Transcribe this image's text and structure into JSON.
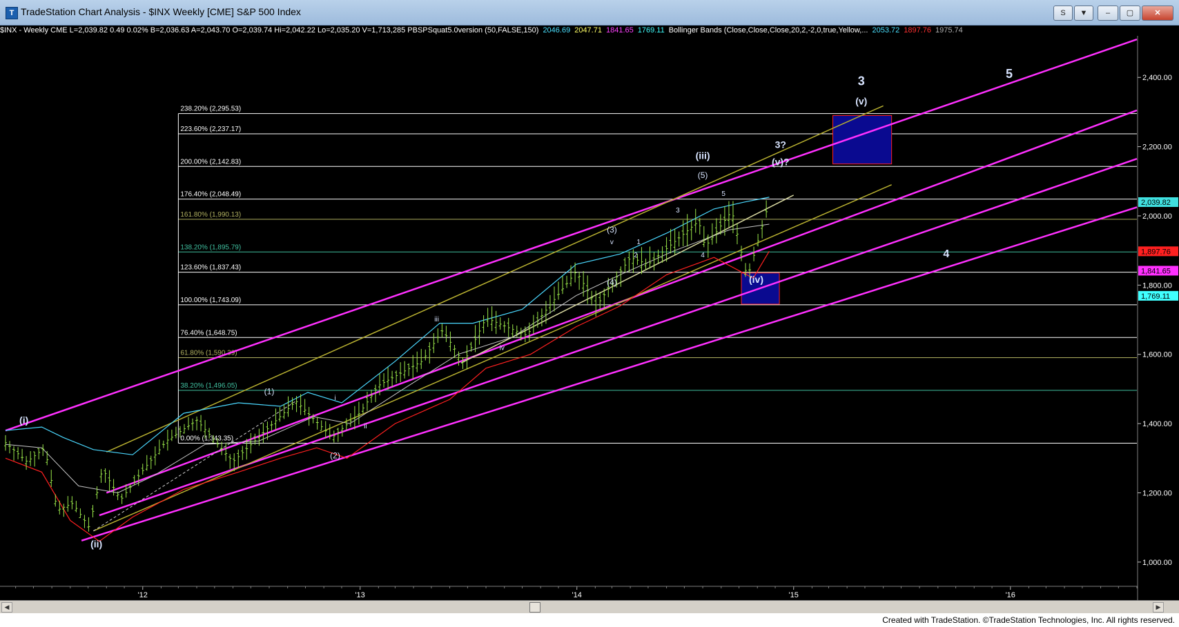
{
  "window": {
    "title": "TradeStation Chart Analysis - $INX Weekly [CME] S&P 500 Index",
    "btn_s": "S",
    "btn_chart": "▼",
    "btn_min": "–",
    "btn_max": "▢",
    "btn_close": "✕"
  },
  "status_line": [
    {
      "text": "$INX - Weekly  CME  L=2,039.82  0.49  0.02%  B=2,036.63  A=2,043.70  O=2,039.74  Hi=2,042.22  Lo=2,035.20  V=1,713,285  PBSPSquat5.0version (50,FALSE,150)",
      "color": "#ffffff"
    },
    {
      "text": "2046.69",
      "color": "#4ae0ff"
    },
    {
      "text": "2047.71",
      "color": "#ffff66"
    },
    {
      "text": "1841.65",
      "color": "#ff40ff"
    },
    {
      "text": "1769.11",
      "color": "#40ffff"
    },
    {
      "text": "Bollinger Bands (Close,Close,Close,20,2,-2,0,true,Yellow,...",
      "color": "#ffffff"
    },
    {
      "text": "2053.72",
      "color": "#4ae0ff"
    },
    {
      "text": "1897.76",
      "color": "#ff3030"
    },
    {
      "text": "1975.74",
      "color": "#b0b0b0"
    }
  ],
  "footer": {
    "text": "Created with TradeStation. ©TradeStation Technologies, Inc. All rights reserved."
  },
  "colors": {
    "channel": "#ff30ff",
    "yellow_channel": "#b8b030",
    "bar": "#9be84a",
    "bb_upper": "#4ad8ff",
    "bb_lower": "#ff2020",
    "bb_mid": "#c8c8c8",
    "label": "#d8e4ff",
    "fib_white": "#ffffff",
    "fib_olive": "#b0b060",
    "fib_teal": "#40c0a0",
    "box": "#0a0a90"
  },
  "chart_data": {
    "type": "candlestick",
    "y_range": [
      930,
      2520
    ],
    "y_ticks": [
      1000,
      1200,
      1400,
      1600,
      1800,
      2000,
      2200,
      2400
    ],
    "y_tick_labels": [
      "1,000.00",
      "1,200.00",
      "1,400.00",
      "1,600.00",
      "1,800.00",
      "2,000.00",
      "2,200.00",
      "2,400.00"
    ],
    "x_range": [
      "2011-05-15",
      "2016-08-01"
    ],
    "x_ticks": [
      {
        "date": "2012-01-01",
        "label": "'12"
      },
      {
        "date": "2013-01-01",
        "label": "'13"
      },
      {
        "date": "2014-01-01",
        "label": "'14"
      },
      {
        "date": "2015-01-01",
        "label": "'15"
      },
      {
        "date": "2016-01-01",
        "label": "'16"
      }
    ],
    "price_path": [
      [
        "2011-05-15",
        1345
      ],
      [
        "2011-06-20",
        1290
      ],
      [
        "2011-07-20",
        1330
      ],
      [
        "2011-08-10",
        1150
      ],
      [
        "2011-09-05",
        1170
      ],
      [
        "2011-10-03",
        1100
      ],
      [
        "2011-10-25",
        1270
      ],
      [
        "2011-11-25",
        1180
      ],
      [
        "2011-12-30",
        1260
      ],
      [
        "2012-02-10",
        1350
      ],
      [
        "2012-04-01",
        1410
      ],
      [
        "2012-06-01",
        1290
      ],
      [
        "2012-07-20",
        1370
      ],
      [
        "2012-09-15",
        1465
      ],
      [
        "2012-11-15",
        1360
      ],
      [
        "2012-12-31",
        1430
      ],
      [
        "2013-02-01",
        1510
      ],
      [
        "2013-04-15",
        1580
      ],
      [
        "2013-05-20",
        1670
      ],
      [
        "2013-06-24",
        1575
      ],
      [
        "2013-08-01",
        1705
      ],
      [
        "2013-10-08",
        1655
      ],
      [
        "2013-12-31",
        1840
      ],
      [
        "2014-02-03",
        1740
      ],
      [
        "2014-04-01",
        1880
      ],
      [
        "2014-05-01",
        1860
      ],
      [
        "2014-07-25",
        1985
      ],
      [
        "2014-08-05",
        1910
      ],
      [
        "2014-09-19",
        2015
      ],
      [
        "2014-10-15",
        1820
      ],
      [
        "2014-11-21",
        2042
      ]
    ],
    "last_price": 2039.82,
    "bollinger_upper": [
      [
        "2011-05-15",
        1380
      ],
      [
        "2011-07-15",
        1390
      ],
      [
        "2011-08-20",
        1360
      ],
      [
        "2011-10-10",
        1325
      ],
      [
        "2011-12-15",
        1310
      ],
      [
        "2012-03-10",
        1430
      ],
      [
        "2012-06-10",
        1460
      ],
      [
        "2012-08-20",
        1450
      ],
      [
        "2012-10-05",
        1490
      ],
      [
        "2012-12-01",
        1460
      ],
      [
        "2013-03-01",
        1580
      ],
      [
        "2013-05-15",
        1690
      ],
      [
        "2013-07-10",
        1690
      ],
      [
        "2013-10-01",
        1730
      ],
      [
        "2013-12-31",
        1860
      ],
      [
        "2014-03-15",
        1890
      ],
      [
        "2014-06-01",
        1950
      ],
      [
        "2014-08-20",
        2020
      ],
      [
        "2014-10-10",
        2040
      ],
      [
        "2014-11-21",
        2054
      ]
    ],
    "bollinger_lower": [
      [
        "2011-05-15",
        1300
      ],
      [
        "2011-07-15",
        1260
      ],
      [
        "2011-09-01",
        1120
      ],
      [
        "2011-10-20",
        1060
      ],
      [
        "2011-12-15",
        1130
      ],
      [
        "2012-03-10",
        1210
      ],
      [
        "2012-06-10",
        1260
      ],
      [
        "2012-08-20",
        1300
      ],
      [
        "2012-10-20",
        1330
      ],
      [
        "2012-12-10",
        1300
      ],
      [
        "2013-03-01",
        1400
      ],
      [
        "2013-06-01",
        1470
      ],
      [
        "2013-08-01",
        1560
      ],
      [
        "2013-10-15",
        1600
      ],
      [
        "2013-12-31",
        1680
      ],
      [
        "2014-03-15",
        1740
      ],
      [
        "2014-06-01",
        1830
      ],
      [
        "2014-08-20",
        1880
      ],
      [
        "2014-10-25",
        1820
      ],
      [
        "2014-11-21",
        1898
      ]
    ],
    "bollinger_mid": [
      [
        "2011-05-15",
        1340
      ],
      [
        "2011-07-15",
        1330
      ],
      [
        "2011-09-15",
        1220
      ],
      [
        "2011-11-20",
        1200
      ],
      [
        "2012-01-20",
        1250
      ],
      [
        "2012-04-15",
        1340
      ],
      [
        "2012-07-15",
        1350
      ],
      [
        "2012-10-15",
        1420
      ],
      [
        "2012-12-15",
        1400
      ],
      [
        "2013-03-15",
        1500
      ],
      [
        "2013-06-15",
        1600
      ],
      [
        "2013-09-15",
        1650
      ],
      [
        "2013-12-31",
        1770
      ],
      [
        "2014-03-15",
        1830
      ],
      [
        "2014-06-15",
        1900
      ],
      [
        "2014-09-15",
        1960
      ],
      [
        "2014-11-21",
        1976
      ]
    ],
    "fib_levels": [
      {
        "label": "238.20% (2,295.53)",
        "value": 2295.53,
        "color": "#ffffff"
      },
      {
        "label": "223.60% (2,237.17)",
        "value": 2237.17,
        "color": "#ffffff"
      },
      {
        "label": "200.00% (2,142.83)",
        "value": 2142.83,
        "color": "#ffffff"
      },
      {
        "label": "176.40% (2,048.49)",
        "value": 2048.49,
        "color": "#ffffff"
      },
      {
        "label": "161.80% (1,990.13)",
        "value": 1990.13,
        "color": "#b0b060"
      },
      {
        "label": "138.20% (1,895.79)",
        "value": 1895.79,
        "color": "#40c0a0"
      },
      {
        "label": "123.60% (1,837.43)",
        "value": 1837.43,
        "color": "#ffffff"
      },
      {
        "label": "100.00% (1,743.09)",
        "value": 1743.09,
        "color": "#ffffff"
      },
      {
        "label": "76.40% (1,648.75)",
        "value": 1648.75,
        "color": "#ffffff"
      },
      {
        "label": "61.80% (1,590.39)",
        "value": 1590.39,
        "color": "#b0b060"
      },
      {
        "label": "38.20% (1,496.05)",
        "value": 1496.05,
        "color": "#40c0a0"
      },
      {
        "label": "0.00% (1,343.35)",
        "value": 1343.35,
        "color": "#ffffff"
      }
    ],
    "fib_start_date": "2012-03-01",
    "axis_markers": [
      {
        "value": 2039.82,
        "label": "2,039.82",
        "bg": "#40e0e0",
        "fg": "#000000"
      },
      {
        "value": 1897.76,
        "label": "1,897.76",
        "bg": "#ff2020",
        "fg": "#000000"
      },
      {
        "value": 1841.65,
        "label": "1,841.65",
        "bg": "#ff30ff",
        "fg": "#000000"
      },
      {
        "value": 1769.11,
        "label": "1,769.11",
        "bg": "#40ffff",
        "fg": "#000000"
      }
    ],
    "channel_lines": [
      {
        "from": [
          "2011-05-15",
          1380
        ],
        "to": [
          "2016-08-01",
          2510
        ],
        "color": "#ff30ff"
      },
      {
        "from": [
          "2011-11-01",
          1200
        ],
        "to": [
          "2016-08-01",
          2305
        ],
        "color": "#ff30ff"
      },
      {
        "from": [
          "2011-10-20",
          1135
        ],
        "to": [
          "2016-08-01",
          2165
        ],
        "color": "#ff30ff"
      },
      {
        "from": [
          "2011-09-20",
          1062
        ],
        "to": [
          "2016-08-01",
          2025
        ],
        "color": "#ff30ff"
      }
    ],
    "yellow_lines": [
      {
        "from": [
          "2011-11-01",
          1318
        ],
        "to": [
          "2015-06-01",
          2318
        ],
        "color": "#b8b030"
      },
      {
        "from": [
          "2011-10-10",
          1090
        ],
        "to": [
          "2015-06-15",
          2090
        ],
        "color": "#b8b030"
      },
      {
        "from": [
          "2013-06-20",
          1575
        ],
        "to": [
          "2015-01-01",
          2060
        ],
        "color": "#d8d8a0"
      }
    ],
    "boxes": [
      {
        "x0": "2015-03-08",
        "x1": "2015-06-15",
        "y0": 2150,
        "y1": 2290
      },
      {
        "x0": "2014-10-05",
        "x1": "2014-12-08",
        "y0": 1745,
        "y1": 1835
      }
    ],
    "annotations": [
      {
        "text": "3",
        "date": "2015-04-25",
        "value": 2378,
        "size": 18,
        "bold": true
      },
      {
        "text": "(v)",
        "date": "2015-04-25",
        "value": 2322,
        "size": 14,
        "bold": true
      },
      {
        "text": "5",
        "date": "2015-12-30",
        "value": 2398,
        "size": 18,
        "bold": true
      },
      {
        "text": "3?",
        "date": "2014-12-10",
        "value": 2196,
        "size": 14,
        "bold": true
      },
      {
        "text": "(v)?",
        "date": "2014-12-10",
        "value": 2146,
        "size": 14,
        "bold": true
      },
      {
        "text": "(iii)",
        "date": "2014-08-01",
        "value": 2164,
        "size": 14,
        "bold": true
      },
      {
        "text": "(5)",
        "date": "2014-08-01",
        "value": 2110,
        "size": 12,
        "bold": false
      },
      {
        "text": "5",
        "date": "2014-09-05",
        "value": 2058,
        "size": 10,
        "bold": false
      },
      {
        "text": "3",
        "date": "2014-06-20",
        "value": 2010,
        "size": 10,
        "bold": false
      },
      {
        "text": "4",
        "date": "2014-08-01",
        "value": 1880,
        "size": 10,
        "bold": false
      },
      {
        "text": "(iv)",
        "date": "2014-10-30",
        "value": 1807,
        "size": 14,
        "bold": true
      },
      {
        "text": "4",
        "date": "2015-09-15",
        "value": 1880,
        "size": 16,
        "bold": true
      },
      {
        "text": "(3)",
        "date": "2014-03-01",
        "value": 1952,
        "size": 12,
        "bold": false
      },
      {
        "text": "v",
        "date": "2014-03-01",
        "value": 1918,
        "size": 10,
        "bold": false
      },
      {
        "text": "1",
        "date": "2014-04-15",
        "value": 1918,
        "size": 10,
        "bold": false
      },
      {
        "text": "2",
        "date": "2014-04-10",
        "value": 1880,
        "size": 10,
        "bold": false
      },
      {
        "text": "(4)",
        "date": "2014-03-01",
        "value": 1800,
        "size": 12,
        "bold": false
      },
      {
        "text": "iii",
        "date": "2013-05-10",
        "value": 1695,
        "size": 10,
        "bold": false
      },
      {
        "text": "iv",
        "date": "2013-08-28",
        "value": 1612,
        "size": 10,
        "bold": false
      },
      {
        "text": "(1)",
        "date": "2012-08-01",
        "value": 1485,
        "size": 12,
        "bold": false
      },
      {
        "text": "i",
        "date": "2012-11-20",
        "value": 1468,
        "size": 10,
        "bold": false
      },
      {
        "text": "ii",
        "date": "2013-01-10",
        "value": 1386,
        "size": 10,
        "bold": false
      },
      {
        "text": "(2)",
        "date": "2012-11-20",
        "value": 1300,
        "size": 12,
        "bold": false
      },
      {
        "text": "(i)",
        "date": "2011-06-15",
        "value": 1400,
        "size": 14,
        "bold": true
      },
      {
        "text": "(ii)",
        "date": "2011-10-15",
        "value": 1043,
        "size": 14,
        "bold": true
      }
    ]
  }
}
